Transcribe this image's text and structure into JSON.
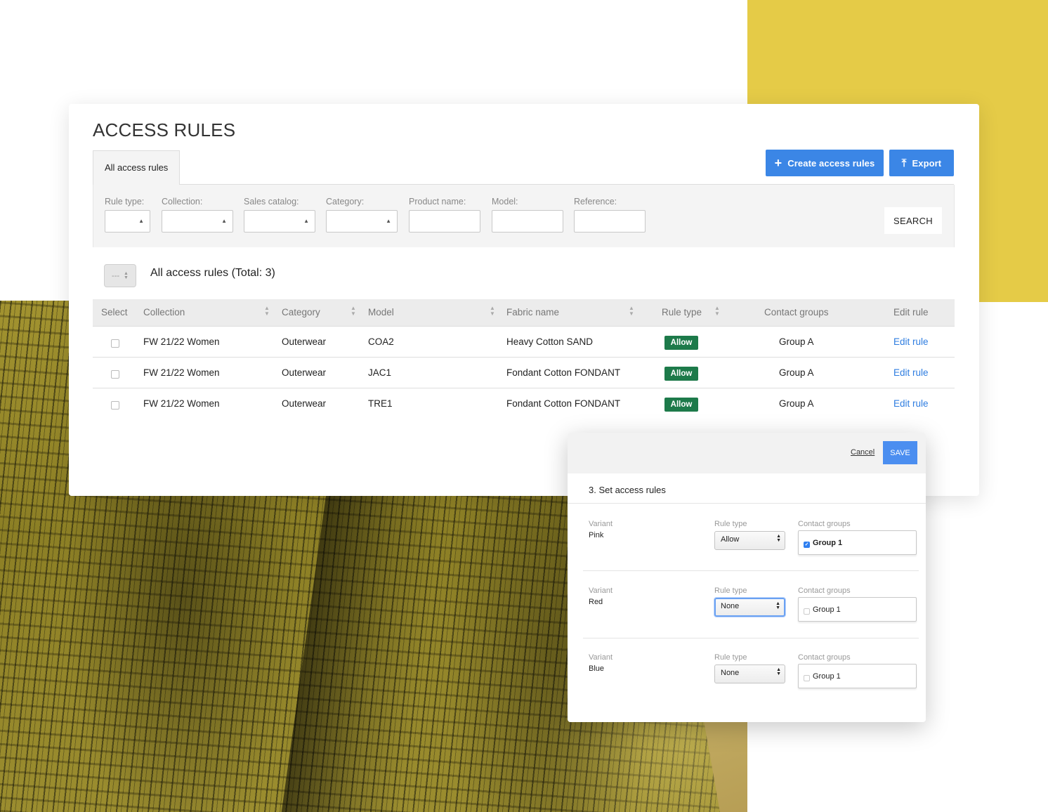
{
  "page": {
    "title": "ACCESS RULES",
    "tab_label": "All access rules",
    "create_button": "Create access rules",
    "export_button": "Export",
    "search_button": "SEARCH",
    "bulk_select_value": "---",
    "total_label": "All access rules (Total: 3)",
    "accent_color": "#3b86e6",
    "allow_badge_color": "#1d7a4a"
  },
  "filters": {
    "rule_type": "Rule type:",
    "collection": "Collection:",
    "sales_catalog": "Sales catalog:",
    "category": "Category:",
    "product_name": "Product name:",
    "model": "Model:",
    "reference": "Reference:"
  },
  "table": {
    "headers": {
      "select": "Select",
      "collection": "Collection",
      "category": "Category",
      "model": "Model",
      "fabric_name": "Fabric name",
      "rule_type": "Rule type",
      "contact_groups": "Contact groups",
      "edit_rule": "Edit rule"
    },
    "rows": [
      {
        "collection": "FW 21/22 Women",
        "category": "Outerwear",
        "model": "COA2",
        "fabric": "Heavy Cotton SAND",
        "rule_type": "Allow",
        "group": "Group A",
        "edit": "Edit rule"
      },
      {
        "collection": "FW 21/22 Women",
        "category": "Outerwear",
        "model": "JAC1",
        "fabric": "Fondant Cotton FONDANT",
        "rule_type": "Allow",
        "group": "Group A",
        "edit": "Edit rule"
      },
      {
        "collection": "FW 21/22 Women",
        "category": "Outerwear",
        "model": "TRE1",
        "fabric": "Fondant Cotton FONDANT",
        "rule_type": "Allow",
        "group": "Group A",
        "edit": "Edit rule"
      }
    ]
  },
  "modal": {
    "cancel": "Cancel",
    "save": "SAVE",
    "title": "3. Set access rules",
    "variant_label": "Variant",
    "rule_type_label": "Rule type",
    "contact_groups_label": "Contact groups",
    "rows": [
      {
        "variant": "Pink",
        "rule_type": "Allow",
        "group": "Group 1",
        "group_checked": true
      },
      {
        "variant": "Red",
        "rule_type": "None",
        "group": "Group 1",
        "group_checked": false
      },
      {
        "variant": "Blue",
        "rule_type": "None",
        "group": "Group 1",
        "group_checked": false
      }
    ]
  },
  "icons": {
    "create": "plus-icon",
    "export": "export-icon",
    "sort": "sort-icon",
    "dropdown": "caret-up-icon"
  }
}
